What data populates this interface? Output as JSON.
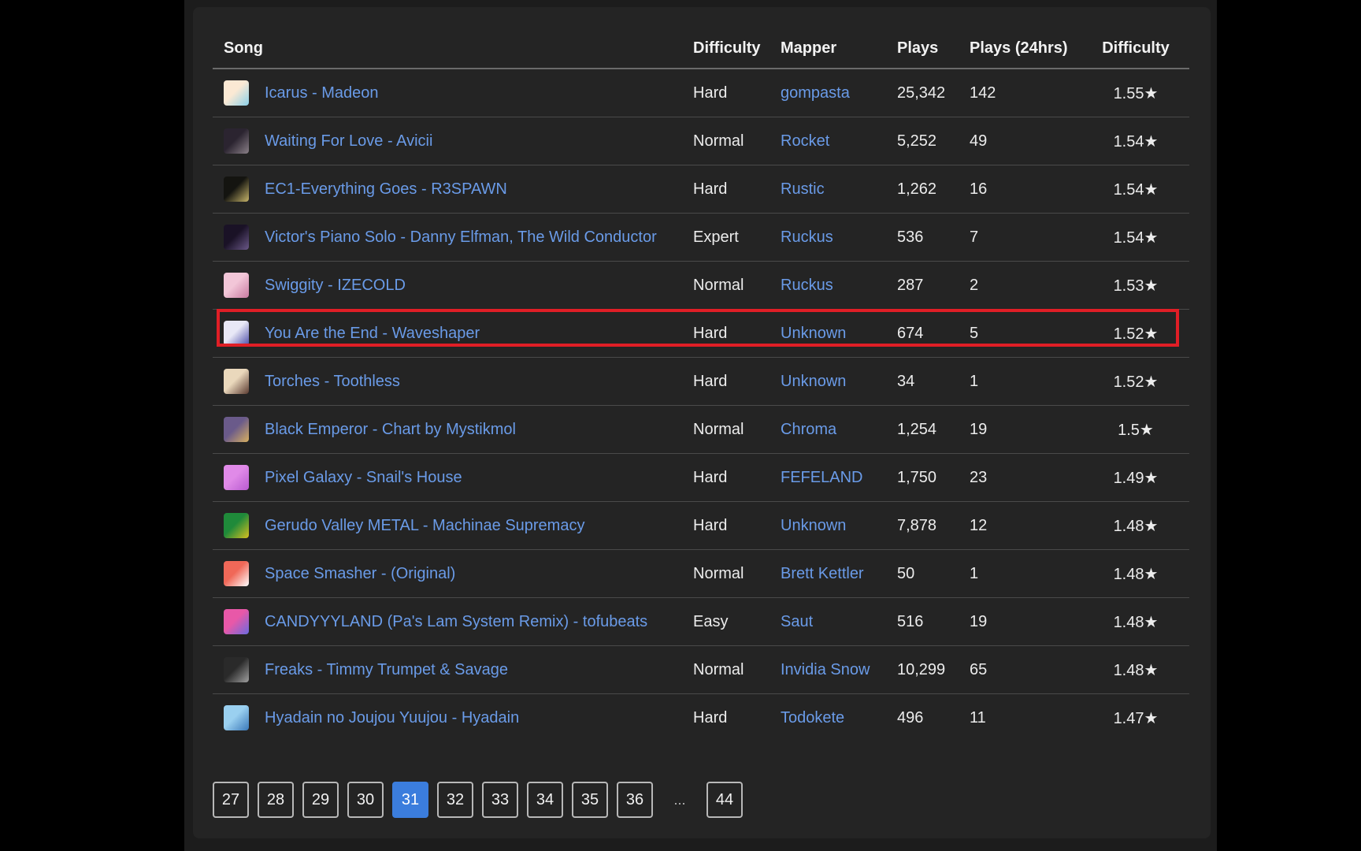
{
  "table": {
    "headers": [
      "Song",
      "Difficulty",
      "Mapper",
      "Plays",
      "Plays (24hrs)",
      "Difficulty"
    ],
    "rows": [
      {
        "thumb": "icarus-cover",
        "thumb_colors": [
          "#fbe9d4",
          "#8ad0e8"
        ],
        "song": "Icarus - Madeon",
        "difficulty": "Hard",
        "mapper": "gompasta",
        "plays": "25,342",
        "plays_24h": "142",
        "stars": "1.55★"
      },
      {
        "thumb": "waiting-for-love-cover",
        "thumb_colors": [
          "#2b2430",
          "#8a8088"
        ],
        "song": "Waiting For Love - Avicii",
        "difficulty": "Normal",
        "mapper": "Rocket",
        "plays": "5,252",
        "plays_24h": "49",
        "stars": "1.54★"
      },
      {
        "thumb": "ec1-cover",
        "thumb_colors": [
          "#141410",
          "#c7b56a"
        ],
        "song": "EC1-Everything Goes - R3SPAWN",
        "difficulty": "Hard",
        "mapper": "Rustic",
        "plays": "1,262",
        "plays_24h": "16",
        "stars": "1.54★"
      },
      {
        "thumb": "victors-piano-cover",
        "thumb_colors": [
          "#1a1226",
          "#6a5888"
        ],
        "song": "Victor's Piano Solo - Danny Elfman, The Wild Conductor",
        "difficulty": "Expert",
        "mapper": "Ruckus",
        "plays": "536",
        "plays_24h": "7",
        "stars": "1.54★"
      },
      {
        "thumb": "swiggity-cover",
        "thumb_colors": [
          "#f2c6d8",
          "#c87aa0"
        ],
        "song": "Swiggity - IZECOLD",
        "difficulty": "Normal",
        "mapper": "Ruckus",
        "plays": "287",
        "plays_24h": "2",
        "stars": "1.53★"
      },
      {
        "thumb": "you-are-the-end-cover",
        "thumb_colors": [
          "#e8e8f6",
          "#4a4aa8"
        ],
        "song": "You Are the End - Waveshaper",
        "difficulty": "Hard",
        "mapper": "Unknown",
        "plays": "674",
        "plays_24h": "5",
        "stars": "1.52★",
        "highlighted": true
      },
      {
        "thumb": "torches-cover",
        "thumb_colors": [
          "#ead8bc",
          "#5a3a30"
        ],
        "song": "Torches - Toothless",
        "difficulty": "Hard",
        "mapper": "Unknown",
        "plays": "34",
        "plays_24h": "1",
        "stars": "1.52★"
      },
      {
        "thumb": "black-emperor-cover",
        "thumb_colors": [
          "#6a5a8a",
          "#d8b060"
        ],
        "song": "Black Emperor - Chart by Mystikmol",
        "difficulty": "Normal",
        "mapper": "Chroma",
        "plays": "1,254",
        "plays_24h": "19",
        "stars": "1.5★"
      },
      {
        "thumb": "pixel-galaxy-cover",
        "thumb_colors": [
          "#e08ae8",
          "#b85ad0"
        ],
        "song": "Pixel Galaxy - Snail's House",
        "difficulty": "Hard",
        "mapper": "FEFELAND",
        "plays": "1,750",
        "plays_24h": "23",
        "stars": "1.49★"
      },
      {
        "thumb": "gerudo-valley-cover",
        "thumb_colors": [
          "#1f8a3a",
          "#d8c020"
        ],
        "song": "Gerudo Valley METAL - Machinae Supremacy",
        "difficulty": "Hard",
        "mapper": "Unknown",
        "plays": "7,878",
        "plays_24h": "12",
        "stars": "1.48★"
      },
      {
        "thumb": "space-smasher-cover",
        "thumb_colors": [
          "#f06858",
          "#ffffff"
        ],
        "song": "Space Smasher - (Original)",
        "difficulty": "Normal",
        "mapper": "Brett Kettler",
        "plays": "50",
        "plays_24h": "1",
        "stars": "1.48★"
      },
      {
        "thumb": "candyyyland-cover",
        "thumb_colors": [
          "#e858a8",
          "#6a6ae0"
        ],
        "song": "CANDYYYLAND (Pa's Lam System Remix) - tofubeats",
        "difficulty": "Easy",
        "mapper": "Saut",
        "plays": "516",
        "plays_24h": "19",
        "stars": "1.48★"
      },
      {
        "thumb": "freaks-cover",
        "thumb_colors": [
          "#2a2a2a",
          "#a0a0a0"
        ],
        "song": "Freaks - Timmy Trumpet & Savage",
        "difficulty": "Normal",
        "mapper": "Invidia Snow",
        "plays": "10,299",
        "plays_24h": "65",
        "stars": "1.48★"
      },
      {
        "thumb": "hyadain-cover",
        "thumb_colors": [
          "#9ad0f0",
          "#3a78b8"
        ],
        "song": "Hyadain no Joujou Yuujou - Hyadain",
        "difficulty": "Hard",
        "mapper": "Todokete",
        "plays": "496",
        "plays_24h": "11",
        "stars": "1.47★"
      }
    ]
  },
  "difficulty_colors": {
    "Easy": "#4caf50",
    "Normal": "#4aa3e8",
    "Hard": "#e5534b",
    "Expert": "#c8283f"
  },
  "link_color": "#6a9be8",
  "highlight_color": "#e01e26",
  "pagination": {
    "pages": [
      "27",
      "28",
      "29",
      "30",
      "31",
      "32",
      "33",
      "34",
      "35",
      "36"
    ],
    "current": "31",
    "ellipsis": "...",
    "last": "44",
    "active_color": "#3b7ddd"
  }
}
